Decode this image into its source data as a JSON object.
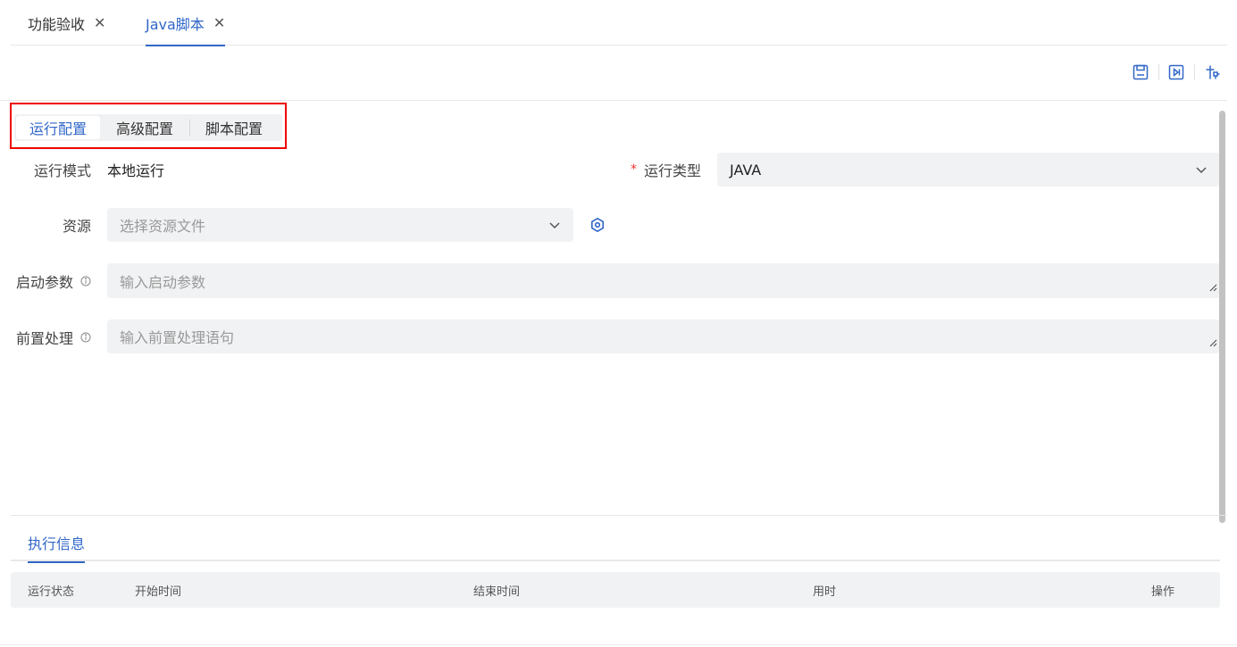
{
  "tabs": [
    {
      "label": "功能验收",
      "active": false
    },
    {
      "label": "Java脚本",
      "active": true
    }
  ],
  "toolbar": {
    "icons": [
      "save-icon",
      "run-icon",
      "debug-icon"
    ]
  },
  "sub_tabs": [
    {
      "label": "运行配置",
      "active": true
    },
    {
      "label": "高级配置",
      "active": false
    },
    {
      "label": "脚本配置",
      "active": false
    }
  ],
  "form": {
    "run_mode": {
      "label": "运行模式",
      "value": "本地运行"
    },
    "run_type": {
      "label": "运行类型",
      "required": true,
      "value": "JAVA"
    },
    "resource": {
      "label": "资源",
      "placeholder": "选择资源文件"
    },
    "startup_params": {
      "label": "启动参数",
      "placeholder": "输入启动参数"
    },
    "preprocess": {
      "label": "前置处理",
      "placeholder": "输入前置处理语句"
    }
  },
  "exec": {
    "tab_label": "执行信息",
    "columns": [
      "运行状态",
      "开始时间",
      "结束时间",
      "用时",
      "操作"
    ]
  },
  "colors": {
    "accent": "#3067c8",
    "highlight_border": "#e00000",
    "required": "#e33333"
  }
}
